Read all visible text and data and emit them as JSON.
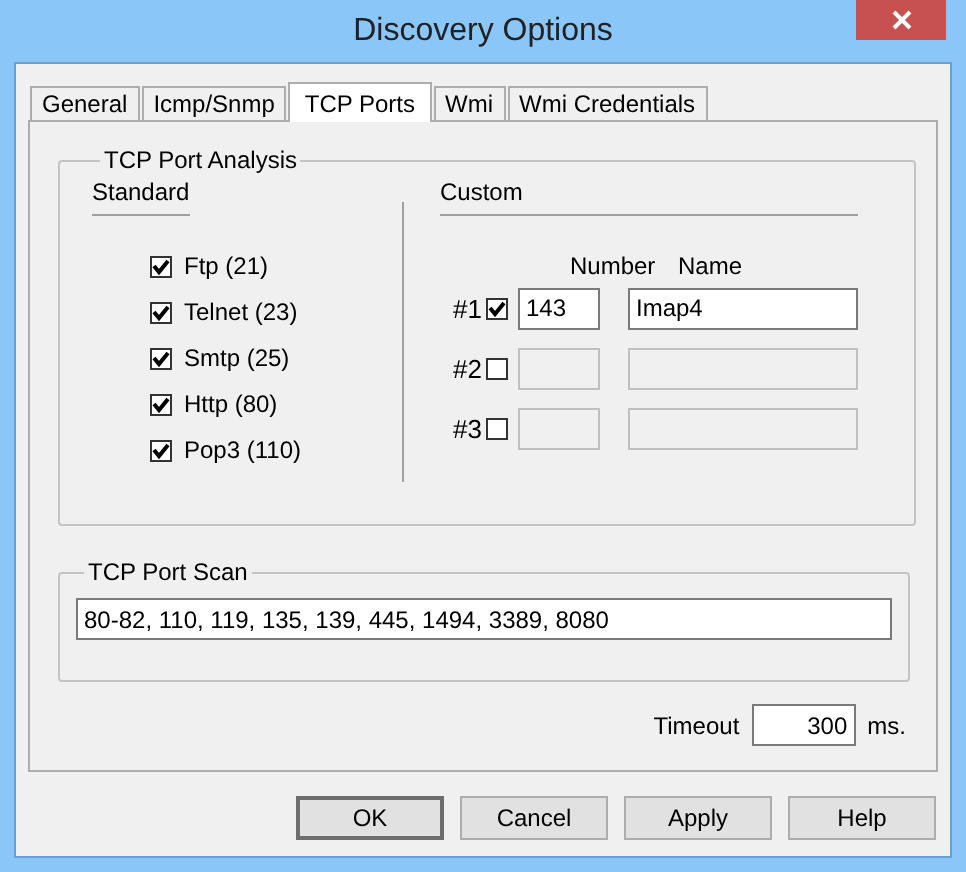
{
  "window": {
    "title": "Discovery Options"
  },
  "tabs": [
    {
      "label": "General",
      "selected": false
    },
    {
      "label": "Icmp/Snmp",
      "selected": false
    },
    {
      "label": "TCP Ports",
      "selected": true
    },
    {
      "label": "Wmi",
      "selected": false
    },
    {
      "label": "Wmi Credentials",
      "selected": false
    }
  ],
  "analysis": {
    "title": "TCP Port Analysis",
    "standard_title": "Standard",
    "custom_title": "Custom",
    "number_header": "Number",
    "name_header": "Name",
    "standard": [
      {
        "label": "Ftp (21)",
        "checked": true
      },
      {
        "label": "Telnet (23)",
        "checked": true
      },
      {
        "label": "Smtp (25)",
        "checked": true
      },
      {
        "label": "Http (80)",
        "checked": true
      },
      {
        "label": "Pop3 (110)",
        "checked": true
      }
    ],
    "custom": [
      {
        "label": "#1",
        "checked": true,
        "number": "143",
        "name": "Imap4"
      },
      {
        "label": "#2",
        "checked": false
      },
      {
        "label": "#3",
        "checked": false
      }
    ]
  },
  "scan": {
    "title": "TCP Port Scan",
    "value": "80-82, 110, 119, 135, 139, 445, 1494, 3389, 8080"
  },
  "timeout": {
    "label": "Timeout",
    "value": "300",
    "unit": "ms."
  },
  "buttons": [
    {
      "label": "OK",
      "default": true
    },
    {
      "label": "Cancel",
      "default": false
    },
    {
      "label": "Apply",
      "default": false
    },
    {
      "label": "Help",
      "default": false
    }
  ]
}
